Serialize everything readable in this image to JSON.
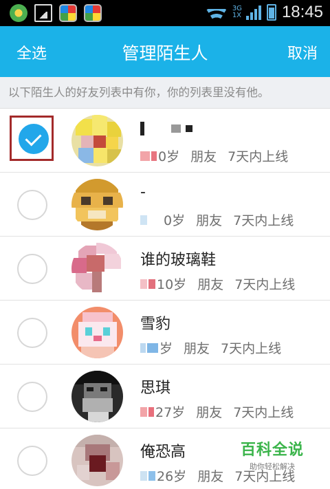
{
  "status_bar": {
    "time": "18:45",
    "network_label_top": "3G",
    "network_label_bottom": "1X",
    "icons": [
      "app-green-icon",
      "photo-icon",
      "app-store-icon",
      "app-store-icon",
      "wifi-icon",
      "signal-icon",
      "battery-icon"
    ]
  },
  "title_bar": {
    "left_action": "全选",
    "title": "管理陌生人",
    "right_action": "取消"
  },
  "notice": "以下陌生人的好友列表中有你，你的列表里没有他。",
  "colors": {
    "accent": "#1bb2e8",
    "checked": "#22a7ea",
    "highlight_border": "#a32a2a",
    "watermark": "#3ab44a"
  },
  "contacts": [
    {
      "name": "",
      "age": "0岁",
      "relation": "朋友",
      "last_online": "7天内上线",
      "selected": true
    },
    {
      "name": "-",
      "age": "0岁",
      "relation": "朋友",
      "last_online": "7天内上线",
      "selected": false
    },
    {
      "name": "谁的玻璃鞋",
      "age": "10岁",
      "relation": "朋友",
      "last_online": "7天内上线",
      "selected": false
    },
    {
      "name": "雪豹",
      "age": "岁",
      "relation": "朋友",
      "last_online": "7天内上线",
      "selected": false
    },
    {
      "name": "思琪",
      "age": "27岁",
      "relation": "朋友",
      "last_online": "7天内上线",
      "selected": false
    },
    {
      "name": "俺恐高",
      "age": "26岁",
      "relation": "朋友",
      "last_online": "7天内上线",
      "selected": false
    }
  ],
  "watermark": {
    "main": "百科全说",
    "sub": "助你轻松解决"
  }
}
